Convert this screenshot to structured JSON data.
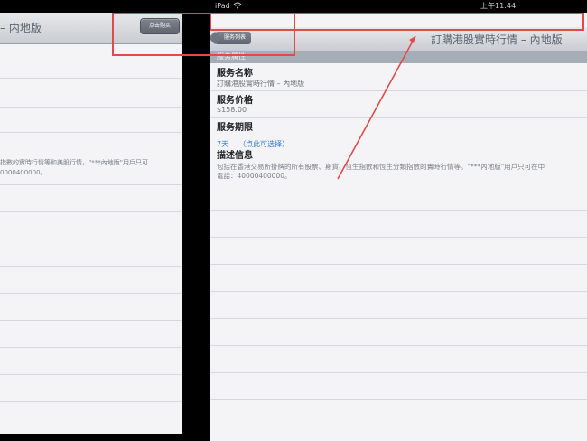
{
  "left": {
    "title": "– 内地版",
    "buy_button": "点击购买",
    "desc_lines": [
      "指數的實時行情等和美股行情，\"***內地版\"用戶只可",
      "0000400000。"
    ]
  },
  "status": {
    "device": "iPad",
    "time": "上午11:44"
  },
  "nav": {
    "back_label": "服务列表",
    "title": "訂購港股實時行情 – 內地版"
  },
  "section": {
    "header": "服务属性"
  },
  "rows": [
    {
      "title": "服务名称",
      "value": "訂購港股實時行情 – 內地版"
    },
    {
      "title": "服务价格",
      "value": "$158.00"
    },
    {
      "title": "服务期限",
      "value": "7天",
      "link": "（点此可选择）"
    },
    {
      "title": "描述信息",
      "value_lines": [
        "包括在香港交易所掛牌的所有股票、期貨、恆生指數和恆生分類指數的實時行情等。\"***內地版\"用戶只可在中",
        "電話：40000400000。"
      ]
    }
  ],
  "colors": {
    "annotation_red": "#e24a4a",
    "link_blue": "#2f78d6"
  }
}
